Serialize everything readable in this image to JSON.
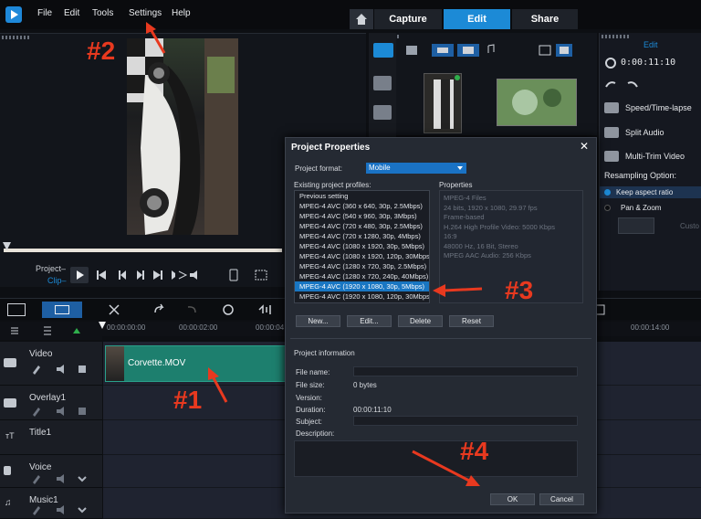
{
  "menu": [
    "File",
    "Edit",
    "Tools",
    "Settings",
    "Help"
  ],
  "mode_tabs": [
    "Capture",
    "Edit",
    "Share"
  ],
  "player": {
    "project_label": "Project–",
    "clip_label": "Clip–"
  },
  "options": {
    "title": "Edit",
    "timecode": "0:00:11:10",
    "items": [
      "Speed/Time-lapse",
      "Split Audio",
      "Multi-Trim Video"
    ],
    "resampling_label": "Resampling Option:",
    "radio_1": "Keep aspect ratio",
    "radio_2": "Pan & Zoom",
    "truncated": "Custo"
  },
  "ruler": [
    "00:00:00:00",
    "00:00:02:00",
    "00:00:04",
    "00:00:14:00"
  ],
  "tracks": [
    "Video",
    "Overlay1",
    "Title1",
    "Voice",
    "Music1"
  ],
  "clip_name": "Corvette.MOV",
  "dialog": {
    "title": "Project Properties",
    "format_label": "Project format:",
    "format_value": "Mobile",
    "profiles_label": "Existing project profiles:",
    "properties_label": "Properties",
    "profiles": [
      "Previous setting",
      "MPEG-4 AVC (360 x 640, 30p, 2.5Mbps)",
      "MPEG-4 AVC (540 x 960, 30p, 3Mbps)",
      "MPEG-4 AVC (720 x 480, 30p, 2.5Mbps)",
      "MPEG-4 AVC (720 x 1280, 30p, 4Mbps)",
      "MPEG-4 AVC (1080 x 1920, 30p, 5Mbps)",
      "MPEG-4 AVC (1080 x 1920, 120p, 30Mbps",
      "MPEG-4 AVC (1280 x 720, 30p, 2.5Mbps)",
      "MPEG-4 AVC (1280 x 720, 240p, 40Mbps)",
      "MPEG-4 AVC (1920 x 1080, 30p, 5Mbps)",
      "MPEG-4 AVC (1920 x 1080, 120p, 30Mbps"
    ],
    "selected_index": 9,
    "properties": [
      "MPEG-4 Files",
      "24 bits, 1920 x 1080, 29.97 fps",
      "Frame-based",
      "H.264 High Profile Video: 5000 Kbps",
      "16:9",
      "48000 Hz, 16 Bit, Stereo",
      "MPEG AAC Audio: 256 Kbps"
    ],
    "buttons": [
      "New...",
      "Edit...",
      "Delete",
      "Reset"
    ],
    "info_label": "Project information",
    "file_name_label": "File name:",
    "file_size_label": "File size:",
    "file_size": "0 bytes",
    "version_label": "Version:",
    "duration_label": "Duration:",
    "duration": "00:00:11:10",
    "subject_label": "Subject:",
    "description_label": "Description:",
    "ok": "OK",
    "cancel": "Cancel"
  },
  "annotations": [
    "#1",
    "#2",
    "#3",
    "#4"
  ],
  "accent_color": "#1c8ad6",
  "annotation_color": "#e8391f"
}
